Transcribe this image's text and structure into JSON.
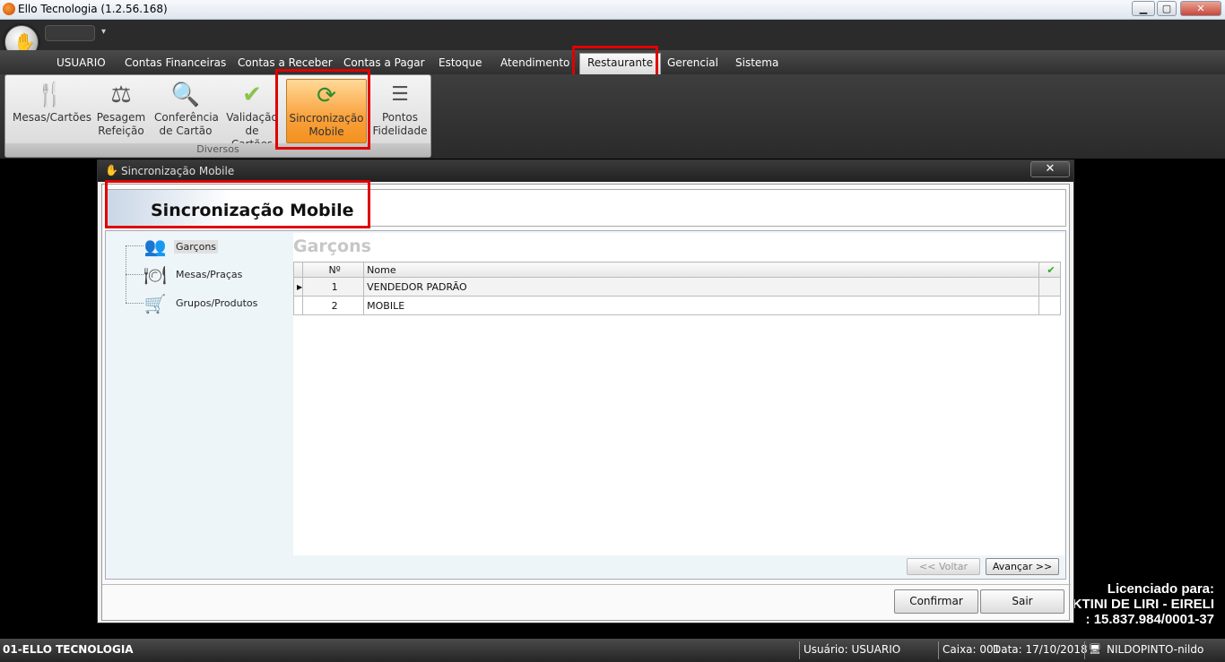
{
  "window": {
    "title": "Ello Tecnologia (1.2.56.168)",
    "minimize": "▁",
    "maximize": "▢",
    "close": "✕"
  },
  "menu": [
    {
      "label": "USUARIO"
    },
    {
      "label": "Contas Financeiras"
    },
    {
      "label": "Contas a Receber"
    },
    {
      "label": "Contas a Pagar"
    },
    {
      "label": "Estoque"
    },
    {
      "label": "Atendimento"
    },
    {
      "label": "Restaurante"
    },
    {
      "label": "Gerencial"
    },
    {
      "label": "Sistema"
    }
  ],
  "ribbon": {
    "group_label": "Diversos",
    "buttons": [
      {
        "line1": "Mesas/Cartões",
        "line2": "",
        "icon": "utensils-icon"
      },
      {
        "line1": "Pesagem",
        "line2": "Refeição",
        "icon": "scale-icon"
      },
      {
        "line1": "Conferência",
        "line2": "de Cartão",
        "icon": "magnifier-icon"
      },
      {
        "line1": "Validação",
        "line2": "de Cartões",
        "icon": "checkmark-icon"
      },
      {
        "line1": "Sincronização",
        "line2": "Mobile",
        "icon": "sync-icon"
      },
      {
        "line1": "Pontos",
        "line2": "Fidelidade",
        "icon": "document-list-icon"
      }
    ]
  },
  "dialog": {
    "title": "Sincronização Mobile",
    "close": "✕",
    "header_title": "Sincronização Mobile",
    "tree": [
      {
        "label": "Garçons",
        "icon": "waiters-icon"
      },
      {
        "label": "Mesas/Praças",
        "icon": "table-icon"
      },
      {
        "label": "Grupos/Produtos",
        "icon": "cart-icon"
      }
    ],
    "section_title": "Garçons",
    "grid": {
      "col_num": "Nº",
      "col_name": "Nome",
      "col_check": "✔",
      "rows": [
        {
          "num": "1",
          "name": "VENDEDOR PADRÃO"
        },
        {
          "num": "2",
          "name": "MOBILE"
        }
      ]
    },
    "back_button": "<< Voltar",
    "next_button": "Avançar >>",
    "confirm_button": "Confirmar",
    "exit_button": "Sair"
  },
  "licence": {
    "line1": "Licenciado para:",
    "line2": "KTINI DE LIRI - EIRELI",
    "line3": ": 15.837.984/0001-37"
  },
  "status": {
    "company": "01-ELLO TECNOLOGIA",
    "user": "Usuário: USUARIO",
    "cash": "Caixa: 001",
    "date": "Data: 17/10/2018",
    "machine": "NILDOPINTO-nildo"
  },
  "colors": {
    "highlight": "#e00000",
    "selected_button": "#f9a13b",
    "check": "#22aa22"
  }
}
